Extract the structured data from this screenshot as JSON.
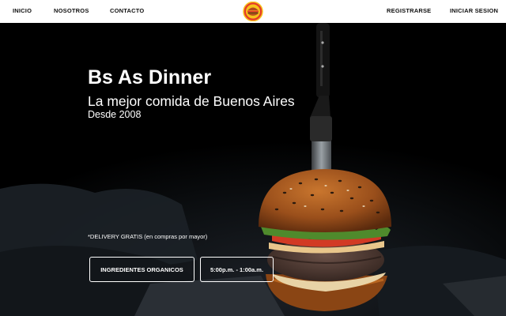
{
  "nav": {
    "left": [
      {
        "label": "INICIO"
      },
      {
        "label": "NOSOTROS"
      },
      {
        "label": "CONTACTO"
      }
    ],
    "right": [
      {
        "label": "REGISTRARSE"
      },
      {
        "label": "INICIAR SESION"
      }
    ],
    "logo_icon": "burger-logo-icon"
  },
  "hero": {
    "title": "Bs As Dinner",
    "subtitle": "La mejor comida de Buenos Aires",
    "since": "Desde 2008",
    "delivery_note": "*DELIVERY GRATIS (en compras por mayor)",
    "buttons": [
      {
        "label": "INGREDIENTES ORGANICOS"
      },
      {
        "label": "5:00p.m. - 1:00a.m."
      }
    ],
    "image_icon": "burger-with-knife-photo"
  },
  "colors": {
    "logo_red": "#e53a2a",
    "logo_yellow": "#f6c21c",
    "navbar_bg": "#ffffff",
    "hero_bg": "#000000"
  }
}
